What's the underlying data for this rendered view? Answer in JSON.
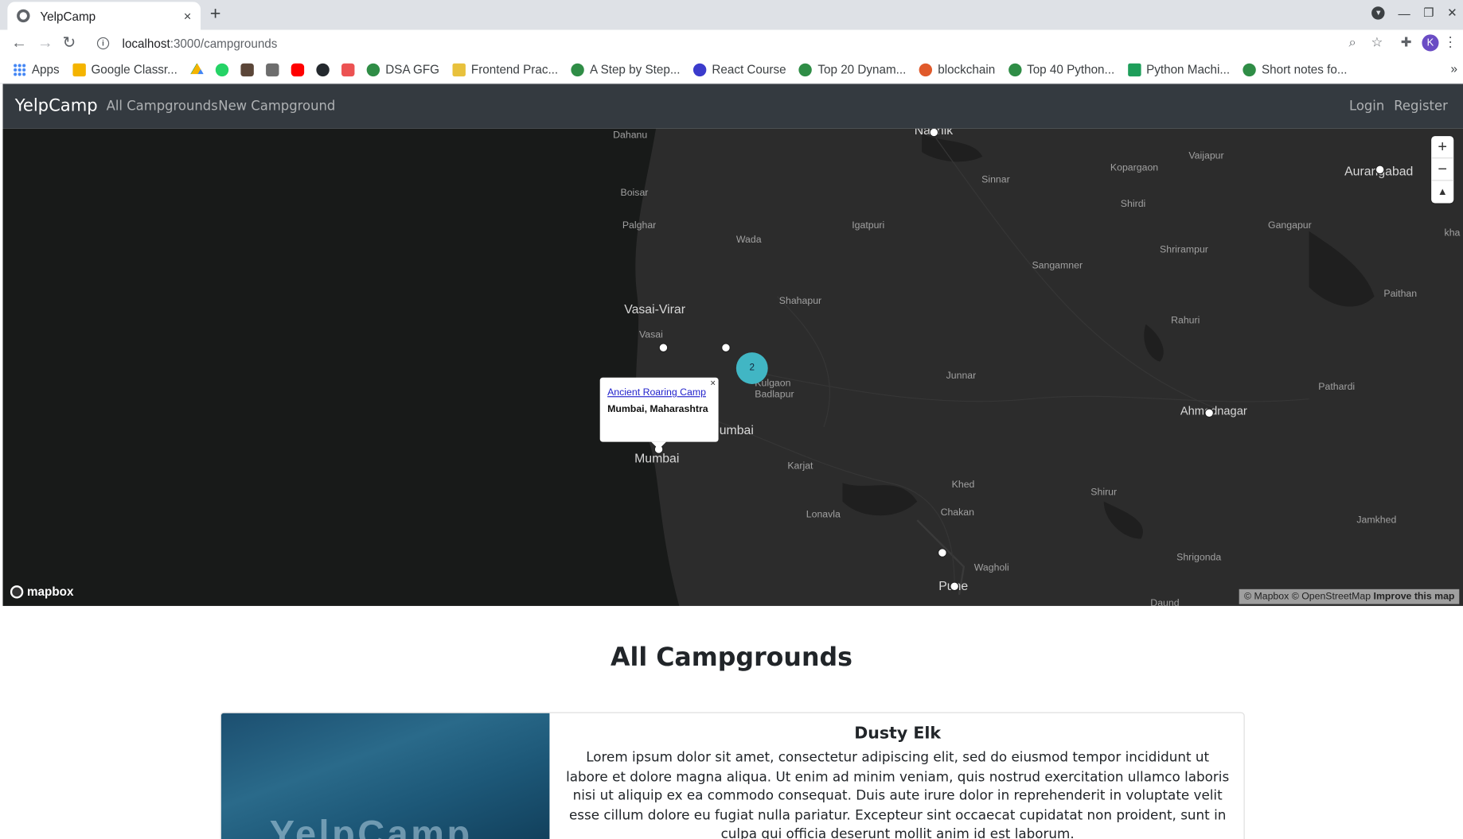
{
  "browser": {
    "tab_title": "YelpCamp",
    "tab_close": "×",
    "new_tab": "+",
    "url_host": "localhost",
    "url_path": ":3000/campgrounds",
    "avatar_letter": "K",
    "bookmarks": [
      {
        "label": "Apps",
        "icon_color": "#4285f4"
      },
      {
        "label": "Google Classr...",
        "icon_color": "#f4b400"
      },
      {
        "label": "DSA GFG",
        "icon_color": "#2f8d46"
      },
      {
        "label": "Frontend Prac...",
        "icon_color": "#e8c13c"
      },
      {
        "label": "A Step by Step...",
        "icon_color": "#2f8d46"
      },
      {
        "label": "React Course",
        "icon_color": "#3b3bcc"
      },
      {
        "label": "Top 20 Dynam...",
        "icon_color": "#2f8d46"
      },
      {
        "label": "blockchain",
        "icon_color": "#e05a2b"
      },
      {
        "label": "Top 40 Python...",
        "icon_color": "#2f8d46"
      },
      {
        "label": "Python Machi...",
        "icon_color": "#1e9e5a"
      },
      {
        "label": "Short notes fo...",
        "icon_color": "#2f8d46"
      }
    ],
    "bookmark_more": "»"
  },
  "nav": {
    "brand": "YelpCamp",
    "all_campgrounds": "All Campgrounds",
    "new_campground": "New Campground",
    "login": "Login",
    "register": "Register"
  },
  "map": {
    "places": {
      "dahanu": "Dahanu",
      "nashik": "Nashik",
      "vaijapur": "Vaijapur",
      "kopargaon": "Kopargaon",
      "aurangabad": "Aurangabad",
      "sinnar": "Sinnar",
      "shirdi": "Shirdi",
      "boisar": "Boisar",
      "palghar": "Palghar",
      "igatpuri": "Igatpuri",
      "gangapur": "Gangapur",
      "khed_edge": "kha",
      "wada": "Wada",
      "shrirampur": "Shrirampur",
      "sangamner": "Sangamner",
      "paithan": "Paithan",
      "vasai_virar": "Vasai-Virar",
      "shahapur": "Shahapur",
      "rahuri": "Rahuri",
      "vasai": "Vasai",
      "junnar": "Junnar",
      "kulgaon_badlapur": "Kulgaon Badlapur",
      "pathardi": "Pathardi",
      "ahmednagar": "Ahmednagar",
      "thane_partial": "umbai",
      "mumbai": "Mumbai",
      "karjat": "Karjat",
      "khed": "Khed",
      "shirur": "Shirur",
      "chakan": "Chakan",
      "lonavla": "Lonavla",
      "jamkhed": "Jamkhed",
      "shrigonda": "Shrigonda",
      "wagholi": "Wagholi",
      "pune": "Pune",
      "daund": "Daund"
    },
    "cluster_count": "2",
    "popup": {
      "title": "Ancient Roaring Camp",
      "location": "Mumbai, Maharashtra",
      "close": "×"
    },
    "zoom_in": "+",
    "zoom_out": "−",
    "compass": "▲",
    "logo": "mapbox",
    "attribution_text": "© Mapbox © OpenStreetMap",
    "attribution_link": "Improve this map"
  },
  "content": {
    "heading": "All Campgrounds",
    "card": {
      "image_text": "YelpCamp",
      "title": "Dusty Elk",
      "text": "Lorem ipsum dolor sit amet, consectetur adipiscing elit, sed do eiusmod tempor incididunt ut labore et dolore magna aliqua. Ut enim ad minim veniam, quis nostrud exercitation ullamco laboris nisi ut aliquip ex ea commodo consequat. Duis aute irure dolor in reprehenderit in voluptate velit esse cillum dolore eu fugiat nulla pariatur. Excepteur sint occaecat cupidatat non proident, sunt in culpa qui officia deserunt mollit anim id est laborum."
    }
  }
}
